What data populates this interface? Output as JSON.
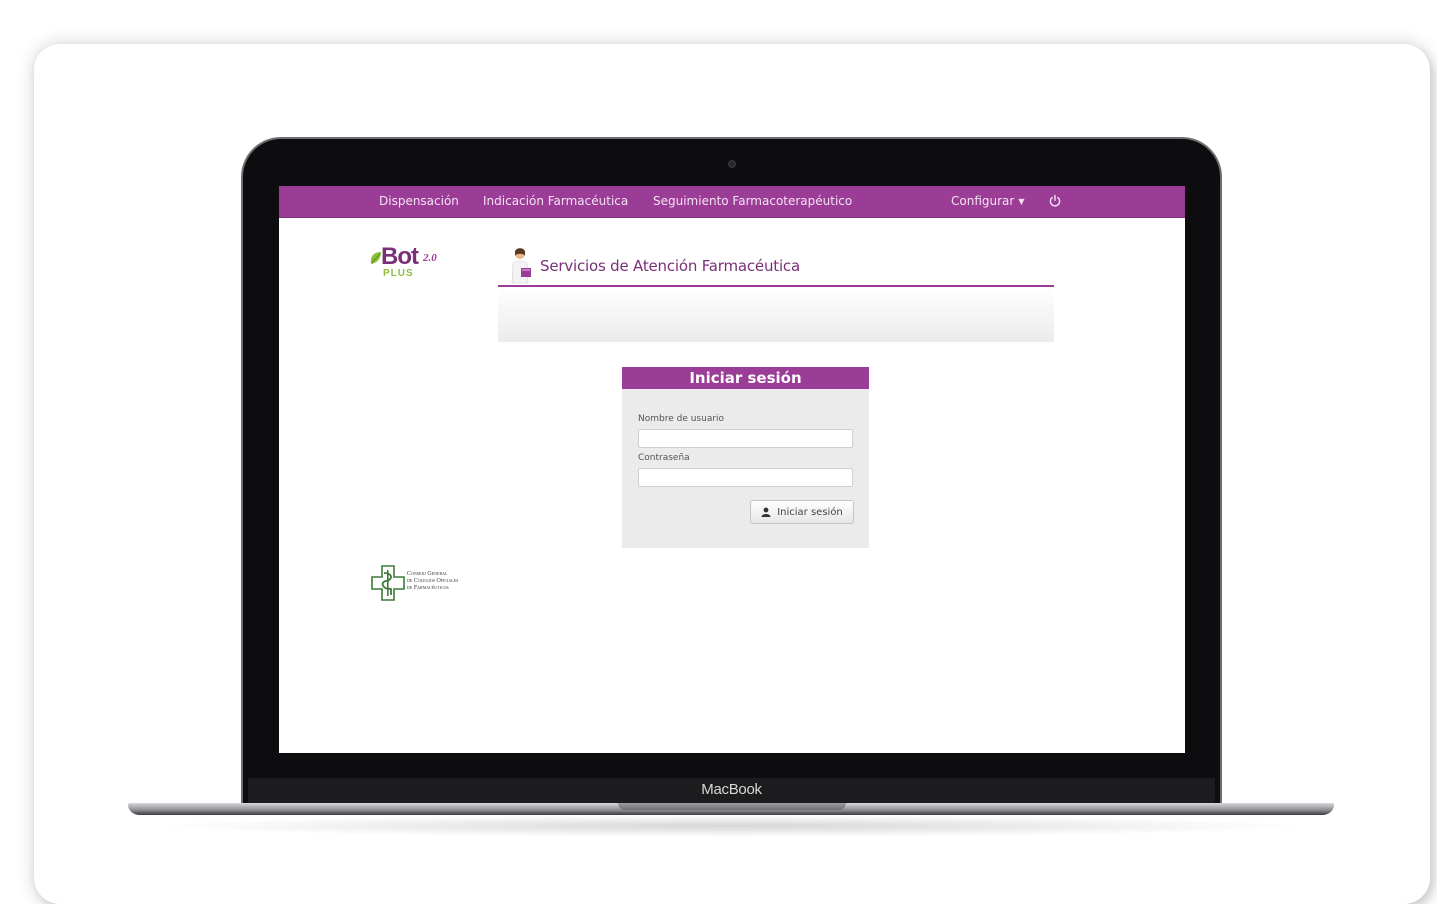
{
  "device": {
    "brand": "MacBook"
  },
  "navbar": {
    "items": [
      {
        "label": "Dispensación"
      },
      {
        "label": "Indicación Farmacéutica"
      },
      {
        "label": "Seguimiento Farmacoterapéutico"
      }
    ],
    "configure_label": "Configurar",
    "accent_color": "#9b3c96"
  },
  "logo": {
    "name": "Bot",
    "version": "2.0",
    "plus": "PLUS"
  },
  "header": {
    "title": "Servicios de Atención Farmacéutica"
  },
  "login": {
    "title": "Iniciar sesión",
    "username_label": "Nombre de usuario",
    "username_value": "",
    "password_label": "Contraseña",
    "password_value": "",
    "submit_label": "Iniciar sesión"
  },
  "footer_logo": {
    "lines": [
      "Consejo General",
      "de Colegios Oficiales",
      "de Farmacéuticos"
    ]
  }
}
